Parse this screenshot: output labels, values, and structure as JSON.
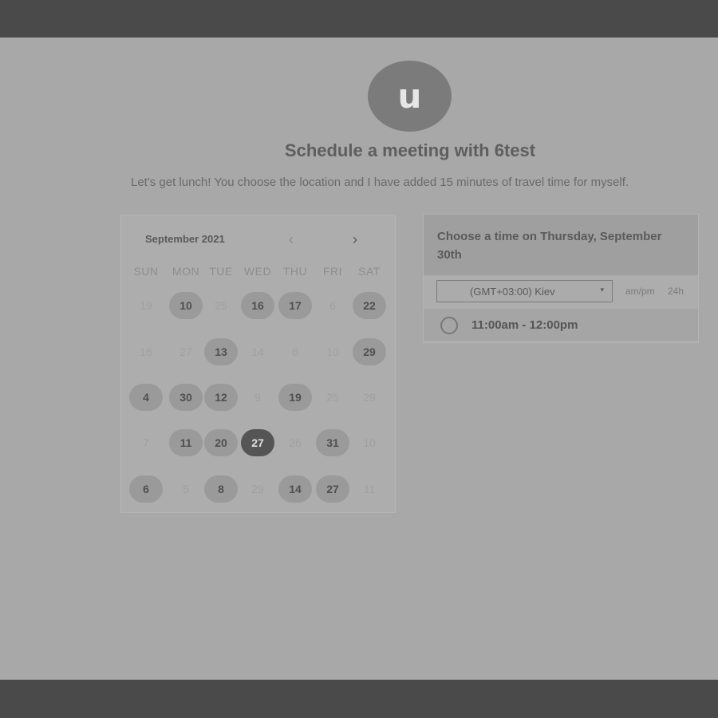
{
  "avatar": {
    "initial": "u"
  },
  "header": {
    "title": "Schedule a meeting with 6test",
    "subtitle": "Let's get lunch! You choose the location and I have added 15 minutes of travel time for myself."
  },
  "calendar": {
    "month_label": "September 2021",
    "prev_label": "‹",
    "next_label": "›",
    "weekdays": [
      "SUN",
      "MON",
      "TUE",
      "WED",
      "THU",
      "FRI",
      "SAT"
    ],
    "weeks": [
      [
        {
          "d": "19",
          "s": "dim"
        },
        {
          "d": "10",
          "s": "avail"
        },
        {
          "d": "25",
          "s": "dim"
        },
        {
          "d": "16",
          "s": "avail"
        },
        {
          "d": "17",
          "s": "avail"
        },
        {
          "d": "6",
          "s": "dim"
        },
        {
          "d": "22",
          "s": "avail"
        }
      ],
      [
        {
          "d": "16",
          "s": "dim"
        },
        {
          "d": "27",
          "s": "dim"
        },
        {
          "d": "13",
          "s": "avail"
        },
        {
          "d": "14",
          "s": "dim"
        },
        {
          "d": "6",
          "s": "dim"
        },
        {
          "d": "10",
          "s": "dim"
        },
        {
          "d": "29",
          "s": "avail"
        }
      ],
      [
        {
          "d": "4",
          "s": "avail"
        },
        {
          "d": "30",
          "s": "avail"
        },
        {
          "d": "12",
          "s": "avail"
        },
        {
          "d": "9",
          "s": "dim"
        },
        {
          "d": "19",
          "s": "avail"
        },
        {
          "d": "25",
          "s": "dim"
        },
        {
          "d": "29",
          "s": "dim"
        }
      ],
      [
        {
          "d": "7",
          "s": "dim"
        },
        {
          "d": "11",
          "s": "avail"
        },
        {
          "d": "20",
          "s": "avail"
        },
        {
          "d": "27",
          "s": "sel"
        },
        {
          "d": "26",
          "s": "dim"
        },
        {
          "d": "31",
          "s": "avail"
        },
        {
          "d": "10",
          "s": "dim"
        }
      ],
      [
        {
          "d": "6",
          "s": "avail"
        },
        {
          "d": "5",
          "s": "dim"
        },
        {
          "d": "8",
          "s": "avail"
        },
        {
          "d": "29",
          "s": "dim"
        },
        {
          "d": "14",
          "s": "avail"
        },
        {
          "d": "27",
          "s": "avail"
        },
        {
          "d": "11",
          "s": "dim"
        }
      ]
    ]
  },
  "time_panel": {
    "title": "Choose a time on Thursday, September 30th",
    "timezone": "(GMT+03:00) Kiev",
    "caret": "▾",
    "format_ampm": "am/pm",
    "format_24h": "24h",
    "slots": [
      "11:00am - 12:00pm"
    ]
  },
  "colors": {
    "overlay_bar": "#4a4a4a",
    "background": "#a8a8a8",
    "selected_day": "#555555",
    "available_day": "#9a9a9a"
  }
}
